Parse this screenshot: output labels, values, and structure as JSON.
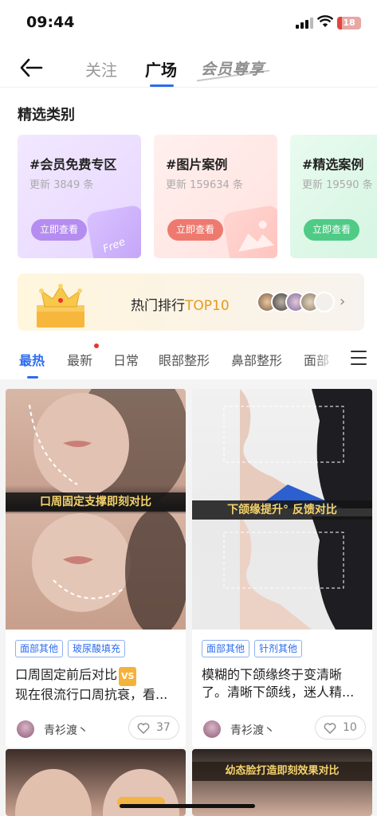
{
  "status": {
    "time": "09:44",
    "battery": "18"
  },
  "header": {
    "tabs": [
      {
        "label": "关注"
      },
      {
        "label": "广场"
      }
    ],
    "vip_tab": "会员尊享"
  },
  "featured": {
    "title": "精选类别",
    "categories": [
      {
        "title": "#会员免费专区",
        "sub": "更新 3849 条",
        "button": "立即查看",
        "deco_text": "Free"
      },
      {
        "title": "#图片案例",
        "sub": "更新 159634 条",
        "button": "立即查看"
      },
      {
        "title": "#精选案例",
        "sub": "更新 19590 条",
        "button": "立即查看"
      }
    ]
  },
  "ranking": {
    "text": "热门排行",
    "highlight": "TOP10"
  },
  "subtabs": [
    "最热",
    "最新",
    "日常",
    "眼部整形",
    "鼻部整形",
    "面部"
  ],
  "feed": [
    {
      "caption": "口周固定支撑即刻对比",
      "tags": [
        "面部其他",
        "玻尿酸填充"
      ],
      "title": "口周固定前后对比",
      "title_badge": "VS",
      "title_line2": "现在很流行口周抗衰，看...",
      "author": "青衫渡丶",
      "likes": "37"
    },
    {
      "caption": "下颌缘提升° 反馈对比",
      "tags": [
        "面部其他",
        "针剂其他"
      ],
      "title": "模糊的下颌缘终于变清晰了。清晰下颌线，迷人精...",
      "author": "青衫渡丶",
      "likes": "10"
    },
    {
      "caption": ""
    },
    {
      "caption": "幼态脸打造即刻效果对比"
    }
  ],
  "colors": {
    "accent": "#2c6cf0",
    "gold": "#e49b1a",
    "red_dot": "#e9352d"
  }
}
